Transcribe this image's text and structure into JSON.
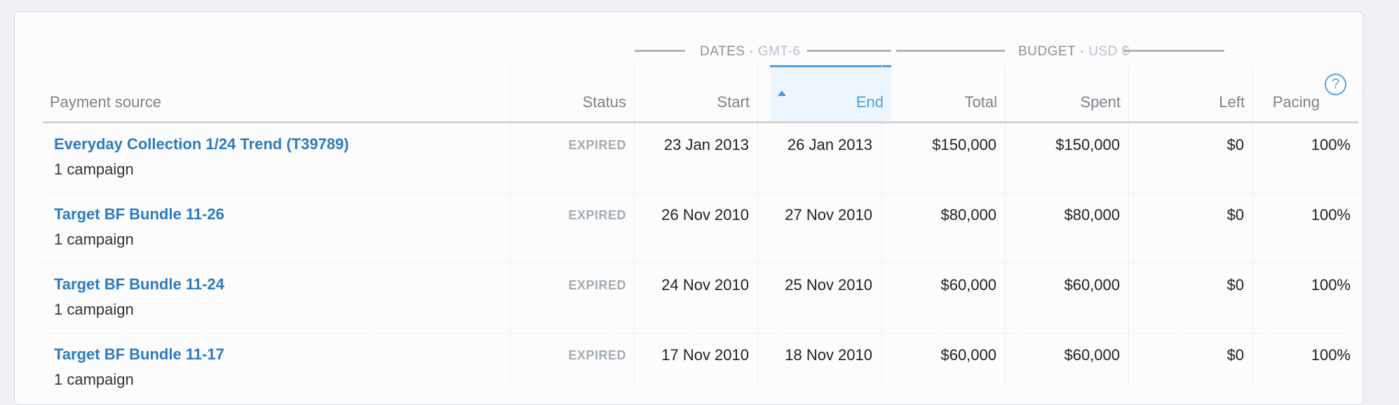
{
  "groups": {
    "dates": {
      "label": "DATES ·",
      "sub": "GMT-6"
    },
    "budget": {
      "label": "BUDGET ·",
      "sub": "USD $"
    }
  },
  "columns": {
    "payment_source": "Payment source",
    "status": "Status",
    "start": "Start",
    "end": "End",
    "total": "Total",
    "spent": "Spent",
    "left": "Left",
    "pacing": "Pacing",
    "help": "?"
  },
  "rows": [
    {
      "name": "Everyday Collection 1/24 Trend (T39789)",
      "campaigns": "1 campaign",
      "status": "EXPIRED",
      "start": "23 Jan 2013",
      "end": "26 Jan 2013",
      "total": "$150,000",
      "spent": "$150,000",
      "left": "$0",
      "pacing": "100%"
    },
    {
      "name": "Target BF Bundle 11-26",
      "campaigns": "1 campaign",
      "status": "EXPIRED",
      "start": "26 Nov 2010",
      "end": "27 Nov 2010",
      "total": "$80,000",
      "spent": "$80,000",
      "left": "$0",
      "pacing": "100%"
    },
    {
      "name": "Target BF Bundle 11-24",
      "campaigns": "1 campaign",
      "status": "EXPIRED",
      "start": "24 Nov 2010",
      "end": "25 Nov 2010",
      "total": "$60,000",
      "spent": "$60,000",
      "left": "$0",
      "pacing": "100%"
    },
    {
      "name": "Target BF Bundle 11-17",
      "campaigns": "1 campaign",
      "status": "EXPIRED",
      "start": "17 Nov 2010",
      "end": "18 Nov 2010",
      "total": "$60,000",
      "spent": "$60,000",
      "left": "$0",
      "pacing": "100%"
    }
  ]
}
